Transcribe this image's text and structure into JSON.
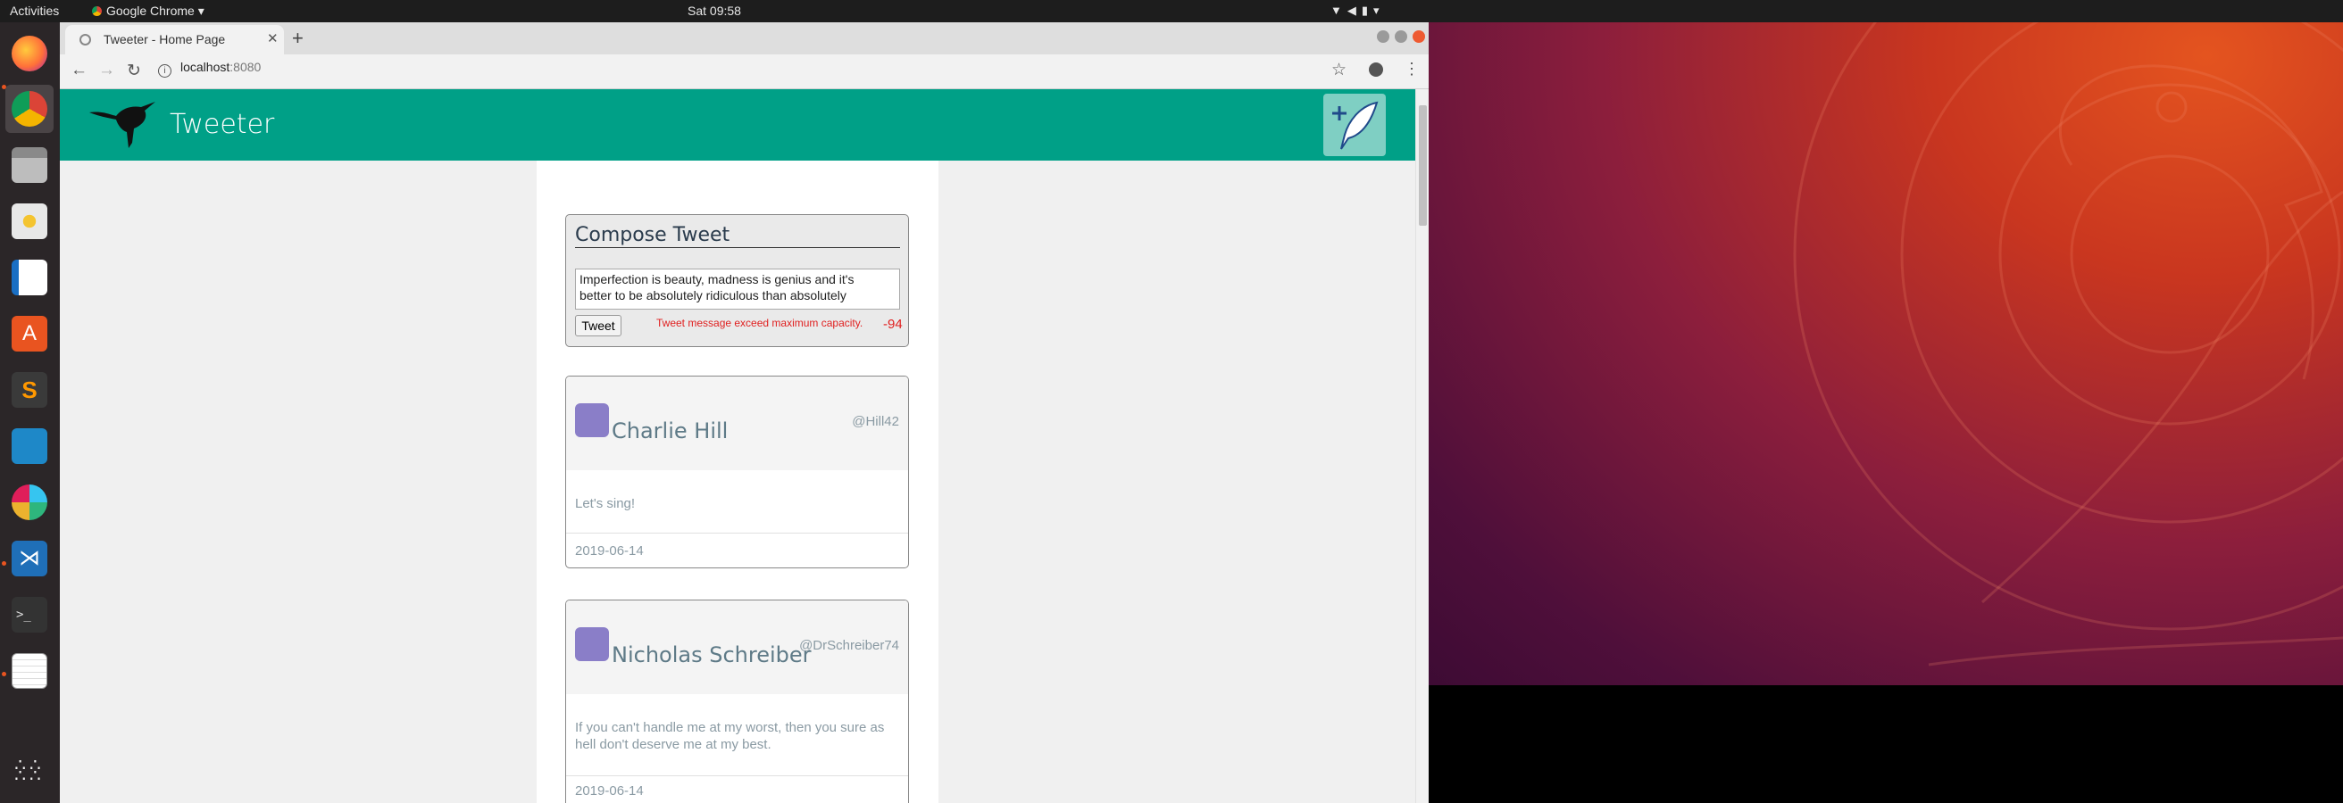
{
  "topbar": {
    "activities": "Activities",
    "app_name": "Google Chrome",
    "clock": "Sat 09:58"
  },
  "browser": {
    "tab_title": "Tweeter - Home Page",
    "url_host": "localhost",
    "url_port": ":8080"
  },
  "app": {
    "title": "Tweeter",
    "compose": {
      "heading": "Compose Tweet",
      "text": "Imperfection is beauty, madness is genius and it's better to be absolutely ridiculous than absolutely",
      "button": "Tweet",
      "error": "Tweet message exceed maximum capacity.",
      "counter": "-94"
    },
    "tweets": [
      {
        "name": "Charlie Hill",
        "handle": "@Hill42",
        "text": "Let's sing!",
        "date": "2019-06-14"
      },
      {
        "name": "Nicholas Schreiber",
        "handle": "@DrSchreiber74",
        "text": "If you can't handle me at my worst, then you sure as hell don't deserve me at my best.",
        "date": "2019-06-14"
      }
    ]
  },
  "colors": {
    "header": "#00a087",
    "error": "#e02020",
    "launcher_accent": "#e95420"
  }
}
